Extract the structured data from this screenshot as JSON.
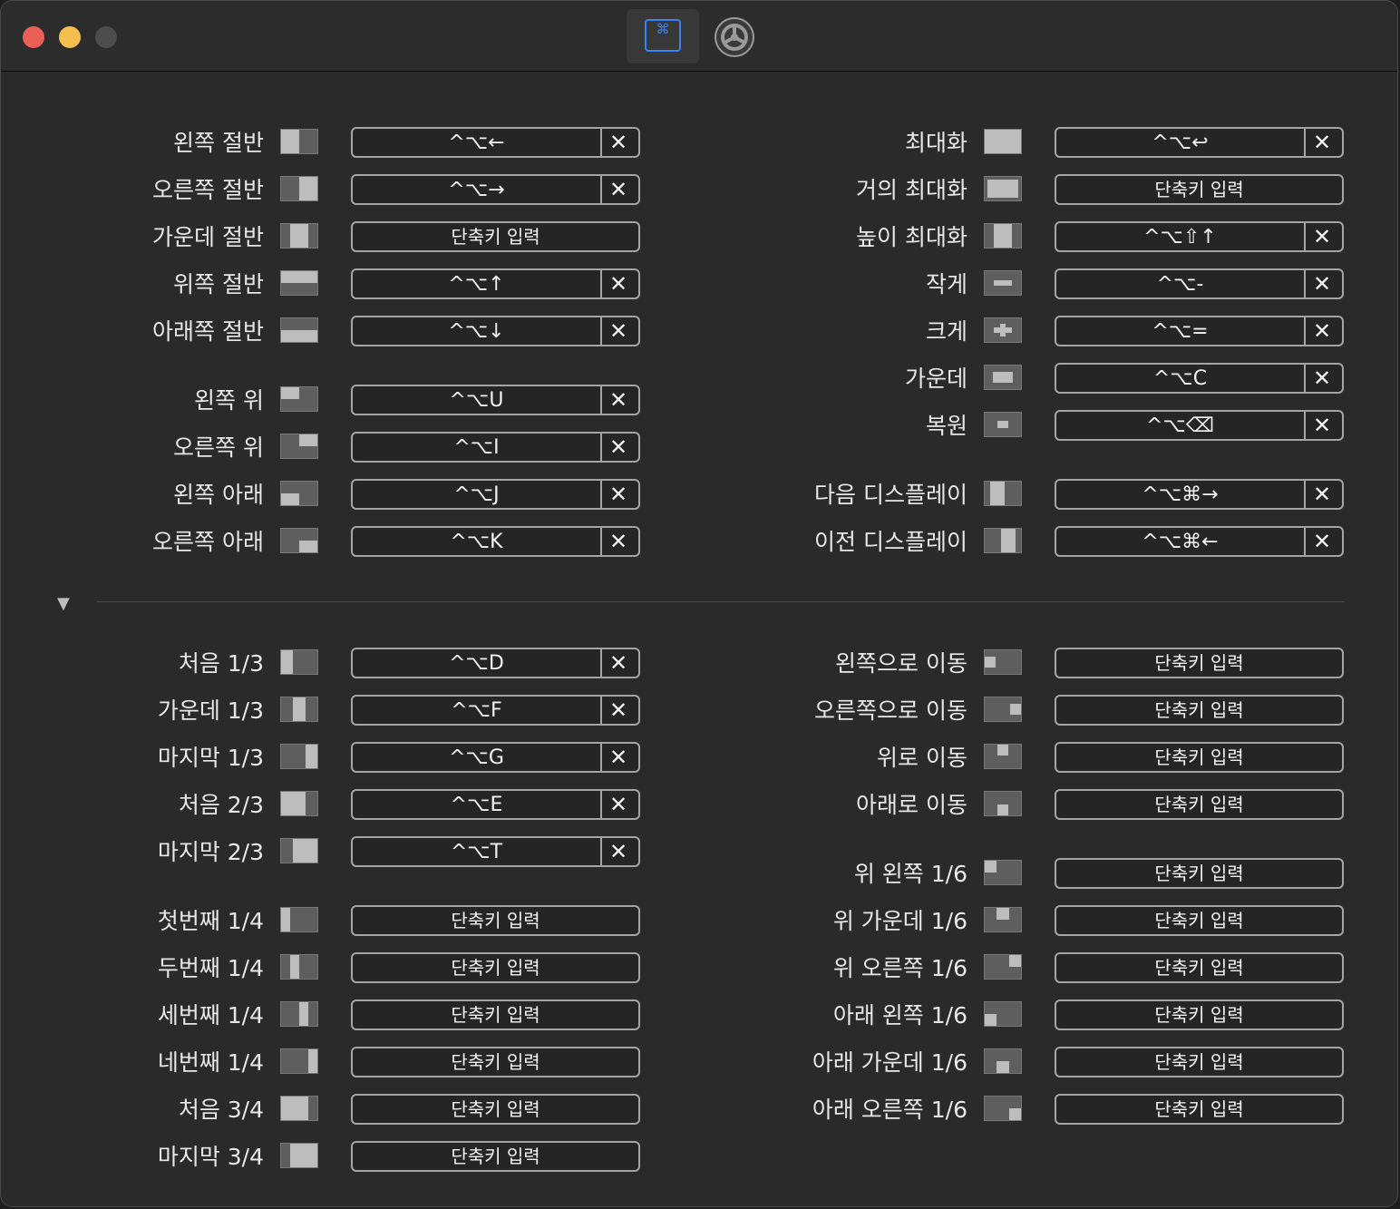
{
  "window": {
    "tab_shortcuts_icon": "command-key-icon",
    "tab_general_icon": "gear-icon",
    "command_symbol": "⌘"
  },
  "placeholder": "단축키 입력",
  "left_top": [
    {
      "label": "왼쪽 절반",
      "icon": "left-half",
      "key": "^⌥←"
    },
    {
      "label": "오른쪽 절반",
      "icon": "right-half",
      "key": "^⌥→"
    },
    {
      "label": "가운데 절반",
      "icon": "center-half",
      "key": ""
    },
    {
      "label": "위쪽 절반",
      "icon": "top-half",
      "key": "^⌥↑"
    },
    {
      "label": "아래쪽 절반",
      "icon": "bottom-half",
      "key": "^⌥↓"
    },
    {
      "label": "왼쪽 위",
      "icon": "top-left",
      "key": "^⌥U"
    },
    {
      "label": "오른쪽 위",
      "icon": "top-right",
      "key": "^⌥I"
    },
    {
      "label": "왼쪽 아래",
      "icon": "bottom-left",
      "key": "^⌥J"
    },
    {
      "label": "오른쪽 아래",
      "icon": "bottom-right",
      "key": "^⌥K"
    }
  ],
  "right_top": [
    {
      "label": "최대화",
      "icon": "maximize",
      "key": "^⌥↩"
    },
    {
      "label": "거의 최대화",
      "icon": "almost-maximize",
      "key": ""
    },
    {
      "label": "높이 최대화",
      "icon": "maximize-height",
      "key": "^⌥⇧↑"
    },
    {
      "label": "작게",
      "icon": "smaller",
      "key": "^⌥-"
    },
    {
      "label": "크게",
      "icon": "larger",
      "key": "^⌥="
    },
    {
      "label": "가운데",
      "icon": "center",
      "key": "^⌥C"
    },
    {
      "label": "복원",
      "icon": "restore",
      "key": "^⌥⌫"
    },
    {
      "label": "다음 디스플레이",
      "icon": "next-display",
      "key": "^⌥⌘→"
    },
    {
      "label": "이전 디스플레이",
      "icon": "previous-display",
      "key": "^⌥⌘←"
    }
  ],
  "left_bottom": [
    {
      "label": "처음 1/3",
      "icon": "first-third",
      "key": "^⌥D"
    },
    {
      "label": "가운데 1/3",
      "icon": "center-third",
      "key": "^⌥F"
    },
    {
      "label": "마지막 1/3",
      "icon": "last-third",
      "key": "^⌥G"
    },
    {
      "label": "처음 2/3",
      "icon": "first-two-thirds",
      "key": "^⌥E"
    },
    {
      "label": "마지막 2/3",
      "icon": "last-two-thirds",
      "key": "^⌥T"
    },
    {
      "label": "첫번째 1/4",
      "icon": "first-fourth",
      "key": ""
    },
    {
      "label": "두번째 1/4",
      "icon": "second-fourth",
      "key": ""
    },
    {
      "label": "세번째 1/4",
      "icon": "third-fourth",
      "key": ""
    },
    {
      "label": "네번째 1/4",
      "icon": "last-fourth",
      "key": ""
    },
    {
      "label": "처음 3/4",
      "icon": "first-three-fourths",
      "key": ""
    },
    {
      "label": "마지막 3/4",
      "icon": "last-three-fourths",
      "key": ""
    }
  ],
  "right_bottom": [
    {
      "label": "왼쪽으로 이동",
      "icon": "move-left",
      "key": ""
    },
    {
      "label": "오른쪽으로 이동",
      "icon": "move-right",
      "key": ""
    },
    {
      "label": "위로 이동",
      "icon": "move-up",
      "key": ""
    },
    {
      "label": "아래로 이동",
      "icon": "move-down",
      "key": ""
    },
    {
      "label": "위 왼쪽 1/6",
      "icon": "top-left-sixth",
      "key": ""
    },
    {
      "label": "위 가운데 1/6",
      "icon": "top-center-sixth",
      "key": ""
    },
    {
      "label": "위 오른쪽 1/6",
      "icon": "top-right-sixth",
      "key": ""
    },
    {
      "label": "아래 왼쪽 1/6",
      "icon": "bottom-left-sixth",
      "key": ""
    },
    {
      "label": "아래 가운데 1/6",
      "icon": "bottom-center-sixth",
      "key": ""
    },
    {
      "label": "아래 오른쪽 1/6",
      "icon": "bottom-right-sixth",
      "key": ""
    }
  ]
}
